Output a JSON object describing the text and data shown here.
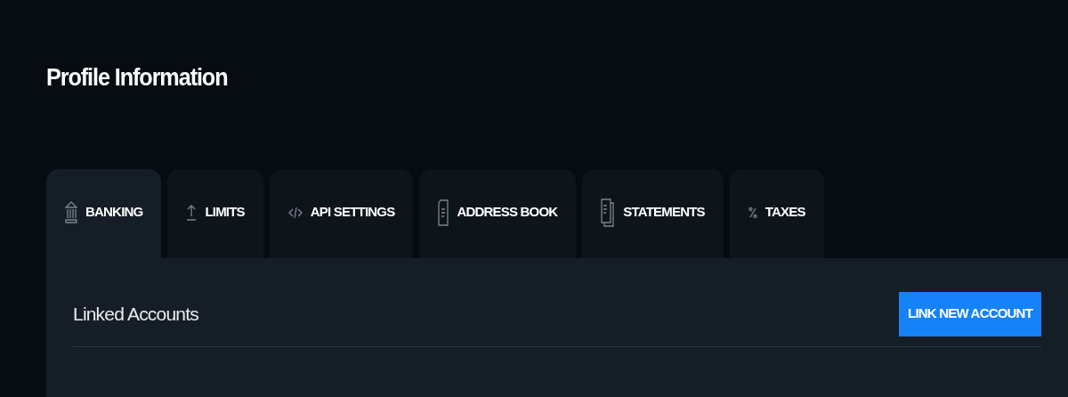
{
  "page": {
    "title": "Profile Information"
  },
  "tabs": [
    {
      "label": "BANKING",
      "selected": true
    },
    {
      "label": "LIMITS",
      "selected": false
    },
    {
      "label": "API SETTINGS",
      "selected": false
    },
    {
      "label": "ADDRESS BOOK",
      "selected": false
    },
    {
      "label": "STATEMENTS",
      "selected": false
    },
    {
      "label": "TAXES",
      "selected": false
    }
  ],
  "panel": {
    "heading": "Linked Accounts",
    "button": "LINK NEW ACCOUNT"
  }
}
